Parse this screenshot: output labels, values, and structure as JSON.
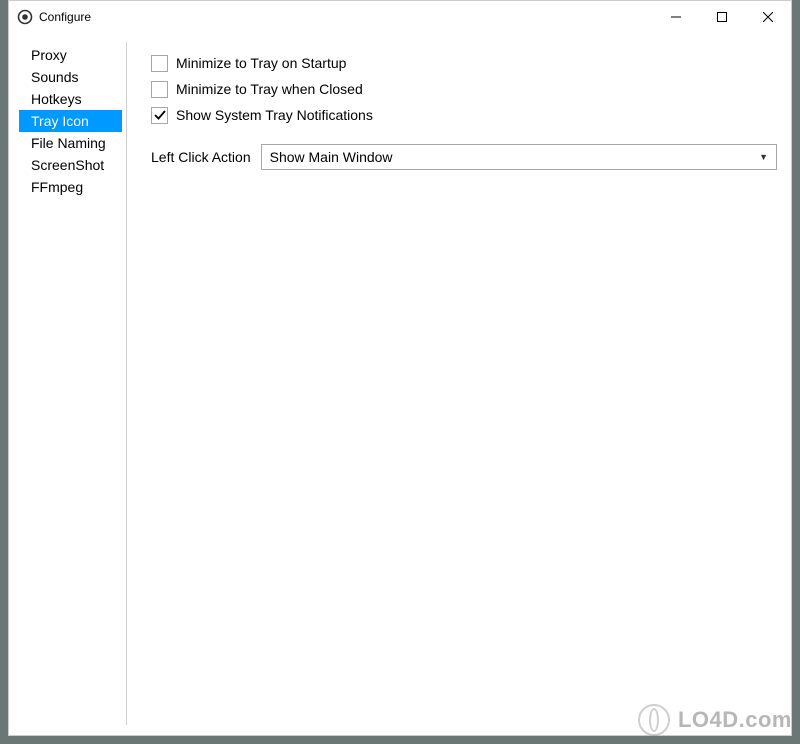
{
  "titlebar": {
    "title": "Configure"
  },
  "sidebar": {
    "items": [
      {
        "label": "Proxy",
        "selected": false
      },
      {
        "label": "Sounds",
        "selected": false
      },
      {
        "label": "Hotkeys",
        "selected": false
      },
      {
        "label": "Tray Icon",
        "selected": true
      },
      {
        "label": "File Naming",
        "selected": false
      },
      {
        "label": "ScreenShot",
        "selected": false
      },
      {
        "label": "FFmpeg",
        "selected": false
      }
    ]
  },
  "main": {
    "checkboxes": [
      {
        "label": "Minimize to Tray on Startup",
        "checked": false
      },
      {
        "label": "Minimize to Tray when Closed",
        "checked": false
      },
      {
        "label": "Show System Tray Notifications",
        "checked": true
      }
    ],
    "leftClick": {
      "label": "Left Click Action",
      "selected": "Show Main Window"
    }
  },
  "watermark": {
    "text": "LO4D.com"
  }
}
